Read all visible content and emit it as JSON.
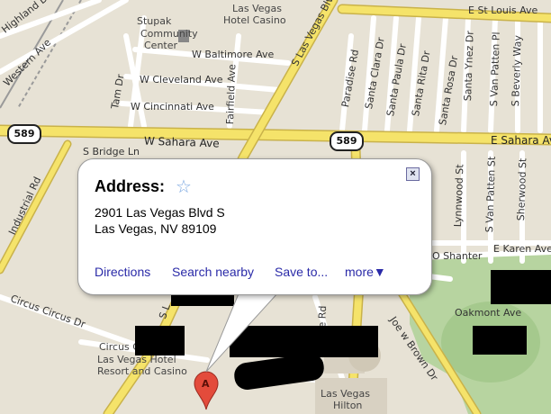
{
  "map": {
    "streets": {
      "e_st_louis_ave": "E St Louis Ave",
      "highland_dr": "Highland Dr",
      "western_ave": "Western Ave",
      "s_las_vegas_blvd": "S Las Vegas Blvd",
      "s_las_vegas_blvd_short": "S L",
      "w_baltimore_ave": "W Baltimore Ave",
      "w_cleveland_ave": "W Cleveland Ave",
      "w_cincinnati_ave": "W Cincinnati Ave",
      "tam_dr": "Tam Dr",
      "fairfield_ave": "Fairfield Ave",
      "paradise_rd": "Paradise Rd",
      "santa_clara_dr": "Santa Clara Dr",
      "santa_paula_dr": "Santa Paula Dr",
      "santa_rita_dr": "Santa Rita Dr",
      "santa_rosa_dr": "Santa Rosa Dr",
      "santa_ynez_dr": "Santa Ynez Dr",
      "s_van_patten_pl": "S Van Patten Pl",
      "s_van_patten_st": "S Van Patten St",
      "s_beverly_way": "S Beverly Way",
      "w_sahara_ave": "W Sahara Ave",
      "e_sahara_ave": "E Sahara Ave",
      "s_bridge_ln": "S Bridge Ln",
      "industrial_rd": "Industrial Rd",
      "lynnwood_st": "Lynnwood St",
      "sherwood_st": "Sherwood St",
      "e_karen_ave": "E Karen Ave",
      "o_shanter": "O Shanter",
      "circus_circus_dr": "Circus Circus Dr",
      "joe_w_brown_dr": "Joe w Brown Dr",
      "oakmont_ave": "Oakmont Ave",
      "paradise_rd_short": "se Rd"
    },
    "highway_shield": "589",
    "pois": {
      "stupak_line1": "Stupak",
      "stupak_line2": "Community",
      "stupak_line3": "Center",
      "lv_hotel_top": "Las Vegas",
      "lv_hotel_top2": "Hotel Casino",
      "circus_line1": "Circus C",
      "circus_line2": "Las Vegas Hotel",
      "circus_line3": "Resort and Casino",
      "lv_hilton1": "Las Vegas",
      "lv_hilton2": "Hilton"
    },
    "marker_label": "A"
  },
  "popup": {
    "title": "Address:",
    "star": "☆",
    "address_line1": "2901 Las Vegas Blvd S",
    "address_line2": "Las Vegas, NV 89109",
    "close": "×",
    "links": {
      "directions": "Directions",
      "search_nearby": "Search nearby",
      "save_to": "Save to...",
      "more": "more▼"
    }
  },
  "colors": {
    "map_bg": "#e7e2d5",
    "major_road": "#f5e36a",
    "minor_road": "#ffffff",
    "park": "#b7d4a0",
    "link": "#2a2aa8"
  }
}
